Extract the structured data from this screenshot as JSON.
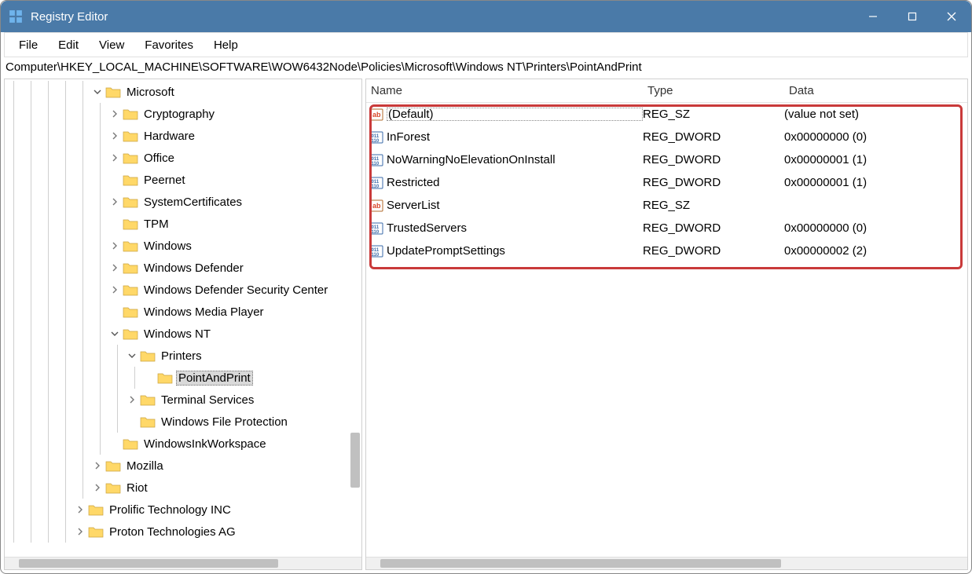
{
  "window": {
    "title": "Registry Editor"
  },
  "menu": {
    "file": "File",
    "edit": "Edit",
    "view": "View",
    "favorites": "Favorites",
    "help": "Help"
  },
  "address": "Computer\\HKEY_LOCAL_MACHINE\\SOFTWARE\\WOW6432Node\\Policies\\Microsoft\\Windows NT\\Printers\\PointAndPrint",
  "tree": [
    {
      "indent": 5,
      "exp": "open",
      "label": "Microsoft"
    },
    {
      "indent": 6,
      "exp": "closed",
      "label": "Cryptography"
    },
    {
      "indent": 6,
      "exp": "closed",
      "label": "Hardware"
    },
    {
      "indent": 6,
      "exp": "closed",
      "label": "Office"
    },
    {
      "indent": 6,
      "exp": "none",
      "label": "Peernet"
    },
    {
      "indent": 6,
      "exp": "closed",
      "label": "SystemCertificates"
    },
    {
      "indent": 6,
      "exp": "none",
      "label": "TPM"
    },
    {
      "indent": 6,
      "exp": "closed",
      "label": "Windows"
    },
    {
      "indent": 6,
      "exp": "closed",
      "label": "Windows Defender"
    },
    {
      "indent": 6,
      "exp": "closed",
      "label": "Windows Defender Security Center"
    },
    {
      "indent": 6,
      "exp": "none",
      "label": "Windows Media Player"
    },
    {
      "indent": 6,
      "exp": "open",
      "label": "Windows NT"
    },
    {
      "indent": 7,
      "exp": "open",
      "label": "Printers"
    },
    {
      "indent": 8,
      "exp": "none",
      "label": "PointAndPrint",
      "selected": true
    },
    {
      "indent": 7,
      "exp": "closed",
      "label": "Terminal Services"
    },
    {
      "indent": 7,
      "exp": "none",
      "label": "Windows File Protection"
    },
    {
      "indent": 6,
      "exp": "none",
      "label": "WindowsInkWorkspace"
    },
    {
      "indent": 5,
      "exp": "closed",
      "label": "Mozilla"
    },
    {
      "indent": 5,
      "exp": "closed",
      "label": "Riot"
    },
    {
      "indent": 4,
      "exp": "closed",
      "label": "Prolific Technology INC"
    },
    {
      "indent": 4,
      "exp": "closed",
      "label": "Proton Technologies AG"
    }
  ],
  "columns": {
    "name": "Name",
    "type": "Type",
    "data": "Data"
  },
  "values": [
    {
      "icon": "sz",
      "name": "(Default)",
      "type": "REG_SZ",
      "data": "(value not set)",
      "selected": true
    },
    {
      "icon": "dword",
      "name": "InForest",
      "type": "REG_DWORD",
      "data": "0x00000000 (0)"
    },
    {
      "icon": "dword",
      "name": "NoWarningNoElevationOnInstall",
      "type": "REG_DWORD",
      "data": "0x00000001 (1)"
    },
    {
      "icon": "dword",
      "name": "Restricted",
      "type": "REG_DWORD",
      "data": "0x00000001 (1)"
    },
    {
      "icon": "sz",
      "name": "ServerList",
      "type": "REG_SZ",
      "data": ""
    },
    {
      "icon": "dword",
      "name": "TrustedServers",
      "type": "REG_DWORD",
      "data": "0x00000000 (0)"
    },
    {
      "icon": "dword",
      "name": "UpdatePromptSettings",
      "type": "REG_DWORD",
      "data": "0x00000002 (2)"
    }
  ]
}
